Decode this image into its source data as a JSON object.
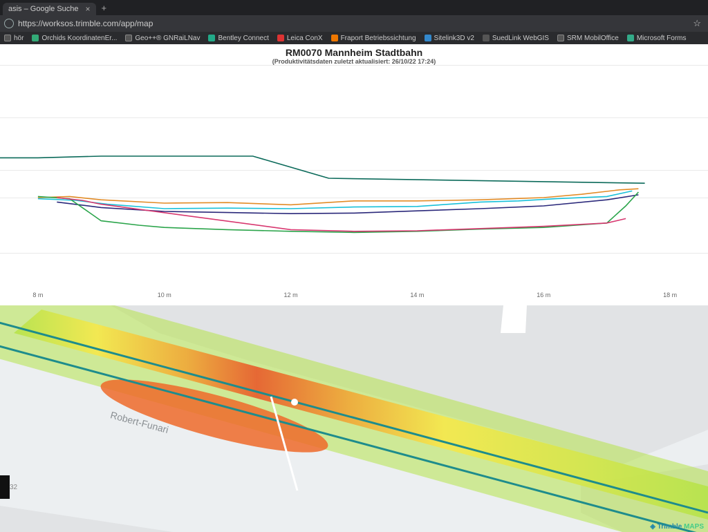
{
  "browser": {
    "tab_title": "asis – Google Suche",
    "address": "https://worksos.trimble.com/app/map"
  },
  "bookmarks": [
    {
      "label": "hör",
      "cls": "b"
    },
    {
      "label": "Orchids KoordinatenEr...",
      "cls": "a"
    },
    {
      "label": "Geo++® GNRaiLNav",
      "cls": "b"
    },
    {
      "label": "Bentley Connect",
      "cls": "c"
    },
    {
      "label": "Leica ConX",
      "cls": "d"
    },
    {
      "label": "Fraport Betriebssichtung",
      "cls": "e"
    },
    {
      "label": "Sitelink3D v2",
      "cls": "f"
    },
    {
      "label": "SuedLink WebGIS",
      "cls": "g"
    },
    {
      "label": "SRM MobilOffice",
      "cls": "b"
    },
    {
      "label": "Microsoft Forms",
      "cls": "h"
    }
  ],
  "header": {
    "title": "RM0070 Mannheim Stadtbahn",
    "subtitle": "(Produktivitätsdaten zuletzt aktualisiert: 26/10/22 17:24)"
  },
  "map": {
    "street_label": "Robert-Funari",
    "provider": "Trimble",
    "provider2": "MAPS",
    "badge_num": "32"
  },
  "chart_data": {
    "type": "line",
    "xlabel": "",
    "ylabel": "",
    "xlim": [
      7.4,
      18.6
    ],
    "ylim": [
      0,
      4
    ],
    "x_ticks": [
      8,
      10,
      12,
      14,
      16,
      18
    ],
    "x_tick_labels": [
      "8 m",
      "10 m",
      "12 m",
      "14 m",
      "16 m",
      "18 m"
    ],
    "grid_y": [
      0.6,
      1.6,
      2.1,
      3.05,
      4.0
    ],
    "series": [
      {
        "name": "dark-teal",
        "color": "#0b6a5a",
        "x": [
          7.4,
          8.0,
          9.0,
          10.0,
          11.4,
          12.6,
          17.6
        ],
        "y": [
          2.32,
          2.32,
          2.35,
          2.35,
          2.35,
          1.95,
          1.86
        ]
      },
      {
        "name": "orange",
        "color": "#e28b26",
        "x": [
          8.0,
          8.5,
          9.0,
          10.0,
          11.0,
          12.0,
          13.0,
          14.0,
          15.0,
          16.0,
          16.6,
          17.2,
          17.5
        ],
        "y": [
          1.6,
          1.62,
          1.56,
          1.5,
          1.51,
          1.47,
          1.54,
          1.54,
          1.56,
          1.6,
          1.66,
          1.74,
          1.76
        ]
      },
      {
        "name": "cyan",
        "color": "#17c0d9",
        "x": [
          8.0,
          8.6,
          9.1,
          10.0,
          11.0,
          12.0,
          13.0,
          14.0,
          15.0,
          15.6,
          16.2,
          17.0,
          17.4
        ],
        "y": [
          1.58,
          1.55,
          1.48,
          1.4,
          1.41,
          1.4,
          1.43,
          1.44,
          1.52,
          1.54,
          1.58,
          1.62,
          1.72
        ]
      },
      {
        "name": "dark-blue",
        "color": "#2a287a",
        "x": [
          8.3,
          9.0,
          10.0,
          11.0,
          12.0,
          13.0,
          14.0,
          15.0,
          16.0,
          17.0,
          17.5
        ],
        "y": [
          1.52,
          1.42,
          1.35,
          1.33,
          1.31,
          1.32,
          1.36,
          1.4,
          1.45,
          1.56,
          1.65
        ]
      },
      {
        "name": "green",
        "color": "#2aa44a",
        "x": [
          8.0,
          8.5,
          9.0,
          9.6,
          10.0,
          11.0,
          12.0,
          13.0,
          14.0,
          15.0,
          16.0,
          17.0,
          17.3,
          17.5
        ],
        "y": [
          1.62,
          1.58,
          1.18,
          1.1,
          1.06,
          1.02,
          0.99,
          0.97,
          0.99,
          1.03,
          1.06,
          1.14,
          1.45,
          1.7
        ]
      },
      {
        "name": "magenta",
        "color": "#d7376f",
        "x": [
          8.3,
          8.7,
          9.0,
          12.0,
          13.0,
          14.0,
          15.0,
          16.0,
          17.0,
          17.3
        ],
        "y": [
          1.6,
          1.55,
          1.48,
          1.02,
          0.99,
          1.0,
          1.04,
          1.08,
          1.14,
          1.22
        ]
      }
    ]
  }
}
